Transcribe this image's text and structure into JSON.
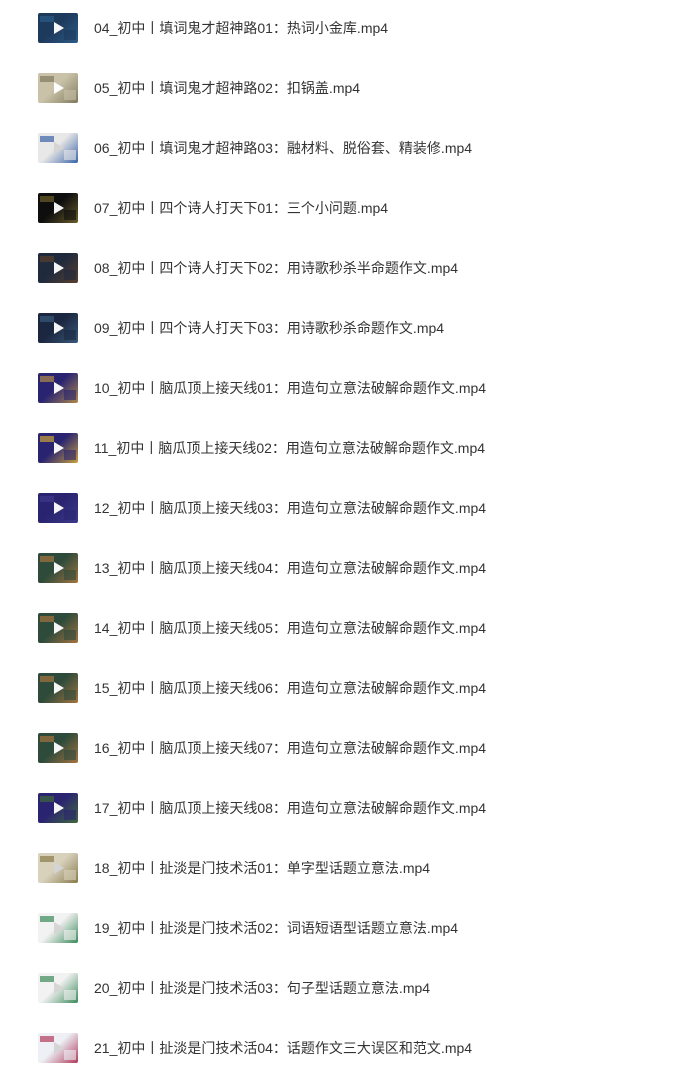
{
  "files": [
    {
      "name": "04_初中丨填词鬼才超神路01：热词小金库.mp4",
      "thumb_colors": [
        "#1d3a5c",
        "#2e5b86"
      ],
      "thumb_icon": "video-thumbnail-icon"
    },
    {
      "name": "05_初中丨填词鬼才超神路02：扣锅盖.mp4",
      "thumb_colors": [
        "#c9c2a8",
        "#7f7a5c"
      ],
      "thumb_icon": "video-thumbnail-icon"
    },
    {
      "name": "06_初中丨填词鬼才超神路03：融材料、脱俗套、精装修.mp4",
      "thumb_colors": [
        "#e8e8e8",
        "#3a63a8"
      ],
      "thumb_icon": "video-thumbnail-icon"
    },
    {
      "name": "07_初中丨四个诗人打天下01：三个小问题.mp4",
      "thumb_colors": [
        "#0e0e0e",
        "#6b5d2a"
      ],
      "thumb_icon": "video-thumbnail-icon"
    },
    {
      "name": "08_初中丨四个诗人打天下02：用诗歌秒杀半命题作文.mp4",
      "thumb_colors": [
        "#1f2a3d",
        "#5a3f2e"
      ],
      "thumb_icon": "video-thumbnail-icon"
    },
    {
      "name": "09_初中丨四个诗人打天下03：用诗歌秒杀命题作文.mp4",
      "thumb_colors": [
        "#1b2740",
        "#385a7a"
      ],
      "thumb_icon": "video-thumbnail-icon"
    },
    {
      "name": "10_初中丨脑瓜顶上接天线01：用造句立意法破解命题作文.mp4",
      "thumb_colors": [
        "#2a2470",
        "#b08a4a"
      ],
      "thumb_icon": "video-thumbnail-icon"
    },
    {
      "name": "11_初中丨脑瓜顶上接天线02：用造句立意法破解命题作文.mp4",
      "thumb_colors": [
        "#2a2470",
        "#c9a23a"
      ],
      "thumb_icon": "video-thumbnail-icon"
    },
    {
      "name": "12_初中丨脑瓜顶上接天线03：用造句立意法破解命题作文.mp4",
      "thumb_colors": [
        "#2a2470",
        "#3d3a8a"
      ],
      "thumb_icon": "video-thumbnail-icon"
    },
    {
      "name": "13_初中丨脑瓜顶上接天线04：用造句立意法破解命题作文.mp4",
      "thumb_colors": [
        "#2e4a3a",
        "#a5743e"
      ],
      "thumb_icon": "video-thumbnail-icon"
    },
    {
      "name": "14_初中丨脑瓜顶上接天线05：用造句立意法破解命题作文.mp4",
      "thumb_colors": [
        "#2e4a3a",
        "#a5743e"
      ],
      "thumb_icon": "video-thumbnail-icon"
    },
    {
      "name": "15_初中丨脑瓜顶上接天线06：用造句立意法破解命题作文.mp4",
      "thumb_colors": [
        "#2e4a3a",
        "#a5743e"
      ],
      "thumb_icon": "video-thumbnail-icon"
    },
    {
      "name": "16_初中丨脑瓜顶上接天线07：用造句立意法破解命题作文.mp4",
      "thumb_colors": [
        "#2e4a3a",
        "#a5743e"
      ],
      "thumb_icon": "video-thumbnail-icon"
    },
    {
      "name": "17_初中丨脑瓜顶上接天线08：用造句立意法破解命题作文.mp4",
      "thumb_colors": [
        "#2a2470",
        "#3f6a3a"
      ],
      "thumb_icon": "video-thumbnail-icon"
    },
    {
      "name": "18_初中丨扯淡是门技术活01：单字型话题立意法.mp4",
      "thumb_colors": [
        "#d8d2bd",
        "#8a7a4a"
      ],
      "thumb_icon": "video-thumbnail-icon"
    },
    {
      "name": "19_初中丨扯淡是门技术活02：词语短语型话题立意法.mp4",
      "thumb_colors": [
        "#f2f2f2",
        "#3a8a5a"
      ],
      "thumb_icon": "video-thumbnail-icon"
    },
    {
      "name": "20_初中丨扯淡是门技术活03：句子型话题立意法.mp4",
      "thumb_colors": [
        "#f2f2f2",
        "#3a8a5a"
      ],
      "thumb_icon": "video-thumbnail-icon"
    },
    {
      "name": "21_初中丨扯淡是门技术活04：话题作文三大误区和范文.mp4",
      "thumb_colors": [
        "#eef0f6",
        "#b03a5a"
      ],
      "thumb_icon": "video-thumbnail-icon"
    }
  ]
}
